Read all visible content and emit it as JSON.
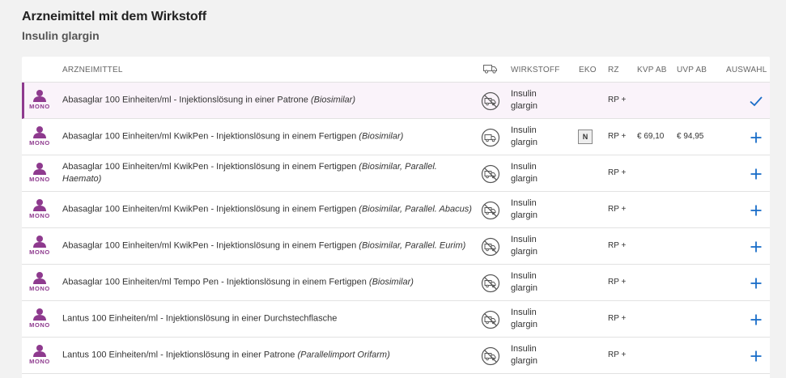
{
  "header": {
    "title": "Arzneimittel mit dem Wirkstoff",
    "subtitle": "Insulin glargin"
  },
  "table": {
    "columns": {
      "name": "ARZNEIMITTEL",
      "wirkstoff": "WIRKSTOFF",
      "eko": "EKO",
      "rz": "RZ",
      "kvp": "KVP AB",
      "uvp": "UVP AB",
      "auswahl": "AUSWAHL"
    },
    "rows": [
      {
        "badge": "MONO",
        "name": "Abasaglar 100 Einheiten/ml - Injektionslösung in einer Patrone",
        "note": "(Biosimilar)",
        "wirk1": "Insulin",
        "wirk2": "glargin",
        "eko": "",
        "rz": "RP +",
        "kvp": "",
        "uvp": "",
        "deliverable": false,
        "selected": true
      },
      {
        "badge": "MONO",
        "name": "Abasaglar 100 Einheiten/ml KwikPen - Injektionslösung in einem Fertigpen",
        "note": "(Biosimilar)",
        "wirk1": "Insulin",
        "wirk2": "glargin",
        "eko": "N",
        "rz": "RP +",
        "kvp": "€ 69,10",
        "uvp": "€ 94,95",
        "deliverable": true,
        "selected": false
      },
      {
        "badge": "MONO",
        "name": "Abasaglar 100 Einheiten/ml KwikPen - Injektionslösung in einem Fertigpen",
        "note": "(Biosimilar, Parallel. Haemato)",
        "wirk1": "Insulin",
        "wirk2": "glargin",
        "eko": "",
        "rz": "RP +",
        "kvp": "",
        "uvp": "",
        "deliverable": false,
        "selected": false
      },
      {
        "badge": "MONO",
        "name": "Abasaglar 100 Einheiten/ml KwikPen - Injektionslösung in einem Fertigpen",
        "note": "(Biosimilar, Parallel. Abacus)",
        "wirk1": "Insulin",
        "wirk2": "glargin",
        "eko": "",
        "rz": "RP +",
        "kvp": "",
        "uvp": "",
        "deliverable": false,
        "selected": false
      },
      {
        "badge": "MONO",
        "name": "Abasaglar 100 Einheiten/ml KwikPen - Injektionslösung in einem Fertigpen",
        "note": "(Biosimilar, Parallel. Eurim)",
        "wirk1": "Insulin",
        "wirk2": "glargin",
        "eko": "",
        "rz": "RP +",
        "kvp": "",
        "uvp": "",
        "deliverable": false,
        "selected": false
      },
      {
        "badge": "MONO",
        "name": "Abasaglar 100 Einheiten/ml Tempo Pen - Injektionslösung in einem Fertigpen",
        "note": "(Biosimilar)",
        "wirk1": "Insulin",
        "wirk2": "glargin",
        "eko": "",
        "rz": "RP +",
        "kvp": "",
        "uvp": "",
        "deliverable": false,
        "selected": false
      },
      {
        "badge": "MONO",
        "name": "Lantus 100 Einheiten/ml - Injektionslösung in einer Durchstechflasche",
        "note": "",
        "wirk1": "Insulin",
        "wirk2": "glargin",
        "eko": "",
        "rz": "RP +",
        "kvp": "",
        "uvp": "",
        "deliverable": false,
        "selected": false
      },
      {
        "badge": "MONO",
        "name": "Lantus 100 Einheiten/ml - Injektionslösung in einer Patrone",
        "note": "(Parallelimport Orifarm)",
        "wirk1": "Insulin",
        "wirk2": "glargin",
        "eko": "",
        "rz": "RP +",
        "kvp": "",
        "uvp": "",
        "deliverable": false,
        "selected": false
      }
    ]
  },
  "icons": {
    "person": "person-icon",
    "truck": "truck-icon",
    "not_deliverable": "truck-crossed-icon",
    "select": "plus-icon",
    "selected": "checkmark-icon"
  },
  "colors": {
    "accent_purple": "#8e3a8e",
    "action_blue": "#1a6dc8",
    "selected_row_bg": "#faf3fa"
  }
}
